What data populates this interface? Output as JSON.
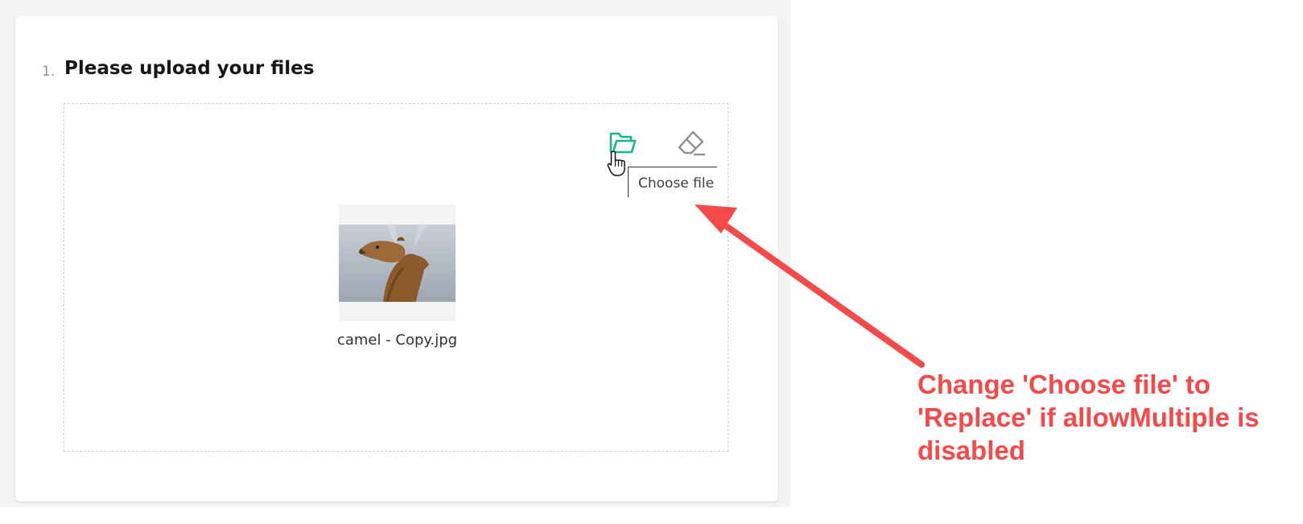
{
  "question": {
    "number": "1.",
    "title": "Please upload your files"
  },
  "toolbar": {
    "choose_file_icon": "folder-open-icon",
    "clear_icon": "eraser-icon",
    "tooltip": "Choose file"
  },
  "file": {
    "name": "camel - Copy.jpg"
  },
  "annotation": {
    "text": "Change 'Choose file' to 'Replace' if allowMultiple is disabled"
  },
  "colors": {
    "accent": "#19b394",
    "annotation": "#f44a4a",
    "icon_gray": "#909090"
  }
}
